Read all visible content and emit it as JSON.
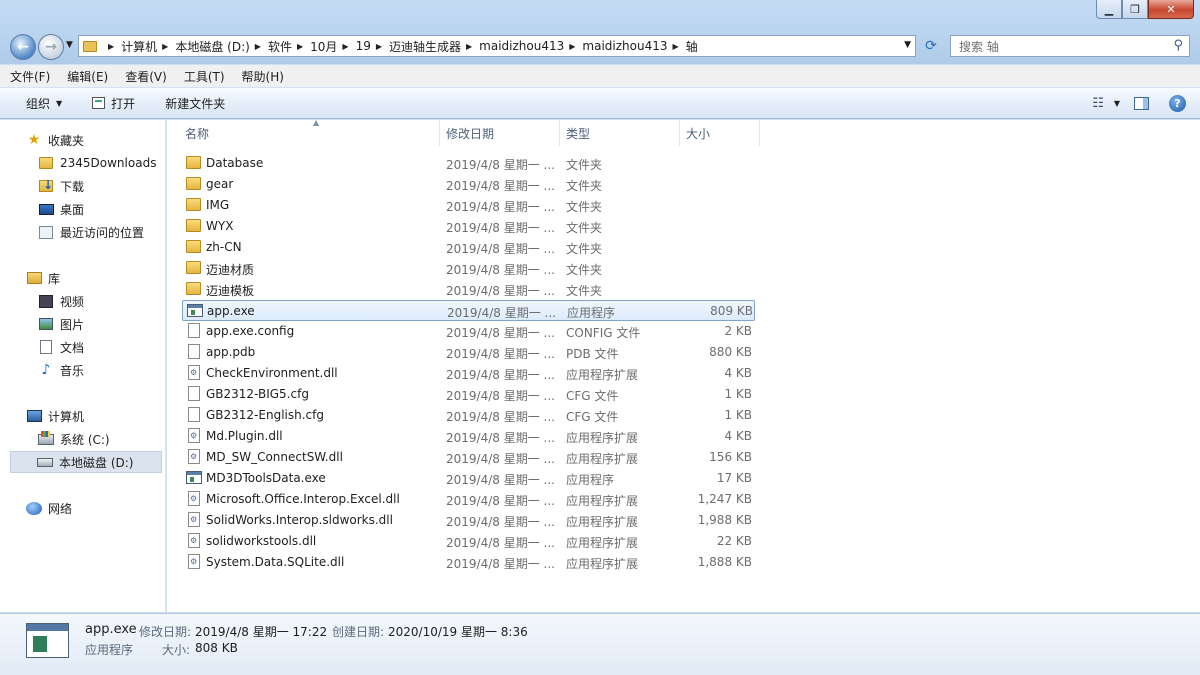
{
  "address": {
    "crumbs": [
      "计算机",
      "本地磁盘 (D:)",
      "软件",
      "10月",
      "19",
      "迈迪轴生成器",
      "maidizhou413",
      "maidizhou413",
      "轴"
    ]
  },
  "search": {
    "placeholder": "搜索 轴"
  },
  "menu": [
    "文件(F)",
    "编辑(E)",
    "查看(V)",
    "工具(T)",
    "帮助(H)"
  ],
  "toolbar": {
    "organize": "组织",
    "open": "打开",
    "new_folder": "新建文件夹"
  },
  "nav": {
    "favorites": {
      "label": "收藏夹",
      "items": [
        "2345Downloads",
        "下载",
        "桌面",
        "最近访问的位置"
      ]
    },
    "libraries": {
      "label": "库",
      "items": [
        "视频",
        "图片",
        "文档",
        "音乐"
      ]
    },
    "computer": {
      "label": "计算机",
      "items": [
        "系统 (C:)",
        "本地磁盘 (D:)"
      ]
    },
    "network": {
      "label": "网络"
    }
  },
  "columns": {
    "name": "名称",
    "date": "修改日期",
    "type": "类型",
    "size": "大小"
  },
  "files": [
    {
      "name": "Database",
      "date": "2019/4/8 星期一 ...",
      "type": "文件夹",
      "size": "",
      "kind": "folder"
    },
    {
      "name": "gear",
      "date": "2019/4/8 星期一 ...",
      "type": "文件夹",
      "size": "",
      "kind": "folder"
    },
    {
      "name": "IMG",
      "date": "2019/4/8 星期一 ...",
      "type": "文件夹",
      "size": "",
      "kind": "folder"
    },
    {
      "name": "WYX",
      "date": "2019/4/8 星期一 ...",
      "type": "文件夹",
      "size": "",
      "kind": "folder"
    },
    {
      "name": "zh-CN",
      "date": "2019/4/8 星期一 ...",
      "type": "文件夹",
      "size": "",
      "kind": "folder"
    },
    {
      "name": "迈迪材质",
      "date": "2019/4/8 星期一 ...",
      "type": "文件夹",
      "size": "",
      "kind": "folder"
    },
    {
      "name": "迈迪模板",
      "date": "2019/4/8 星期一 ...",
      "type": "文件夹",
      "size": "",
      "kind": "folder"
    },
    {
      "name": "app.exe",
      "date": "2019/4/8 星期一 ...",
      "type": "应用程序",
      "size": "809 KB",
      "kind": "exe",
      "selected": true
    },
    {
      "name": "app.exe.config",
      "date": "2019/4/8 星期一 ...",
      "type": "CONFIG 文件",
      "size": "2 KB",
      "kind": "doc"
    },
    {
      "name": "app.pdb",
      "date": "2019/4/8 星期一 ...",
      "type": "PDB 文件",
      "size": "880 KB",
      "kind": "doc"
    },
    {
      "name": "CheckEnvironment.dll",
      "date": "2019/4/8 星期一 ...",
      "type": "应用程序扩展",
      "size": "4 KB",
      "kind": "dll"
    },
    {
      "name": "GB2312-BIG5.cfg",
      "date": "2019/4/8 星期一 ...",
      "type": "CFG 文件",
      "size": "1 KB",
      "kind": "doc"
    },
    {
      "name": "GB2312-English.cfg",
      "date": "2019/4/8 星期一 ...",
      "type": "CFG 文件",
      "size": "1 KB",
      "kind": "doc"
    },
    {
      "name": "Md.Plugin.dll",
      "date": "2019/4/8 星期一 ...",
      "type": "应用程序扩展",
      "size": "4 KB",
      "kind": "dll"
    },
    {
      "name": "MD_SW_ConnectSW.dll",
      "date": "2019/4/8 星期一 ...",
      "type": "应用程序扩展",
      "size": "156 KB",
      "kind": "dll"
    },
    {
      "name": "MD3DToolsData.exe",
      "date": "2019/4/8 星期一 ...",
      "type": "应用程序",
      "size": "17 KB",
      "kind": "exe"
    },
    {
      "name": "Microsoft.Office.Interop.Excel.dll",
      "date": "2019/4/8 星期一 ...",
      "type": "应用程序扩展",
      "size": "1,247 KB",
      "kind": "dll"
    },
    {
      "name": "SolidWorks.Interop.sldworks.dll",
      "date": "2019/4/8 星期一 ...",
      "type": "应用程序扩展",
      "size": "1,988 KB",
      "kind": "dll"
    },
    {
      "name": "solidworkstools.dll",
      "date": "2019/4/8 星期一 ...",
      "type": "应用程序扩展",
      "size": "22 KB",
      "kind": "dll"
    },
    {
      "name": "System.Data.SQLite.dll",
      "date": "2019/4/8 星期一 ...",
      "type": "应用程序扩展",
      "size": "1,888 KB",
      "kind": "dll"
    }
  ],
  "details": {
    "name": "app.exe",
    "modified_label": "修改日期:",
    "modified": "2019/4/8 星期一 17:22",
    "created_label": "创建日期:",
    "created": "2020/10/19 星期一 8:36",
    "type": "应用程序",
    "size_label": "大小:",
    "size": "808 KB"
  }
}
